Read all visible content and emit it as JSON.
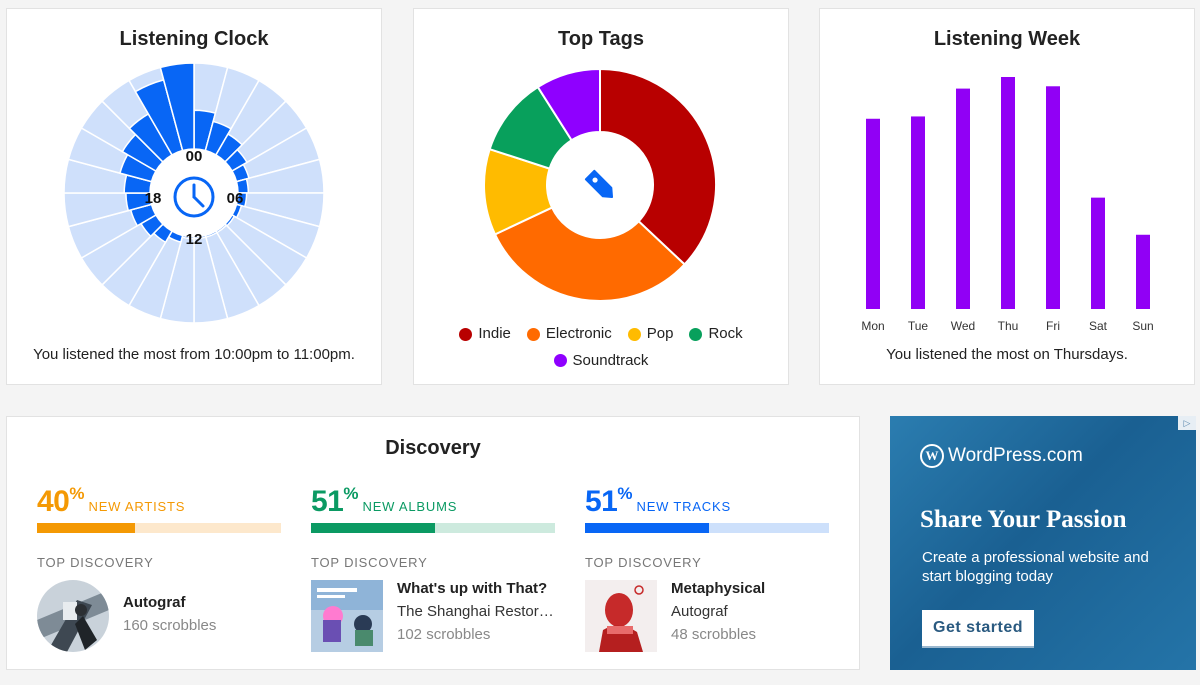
{
  "clock": {
    "title": "Listening Clock",
    "caption": "You listened the most from 10:00pm to 11:00pm.",
    "hour_labels": {
      "top": "00",
      "right": "06",
      "bottom": "12",
      "left": "18"
    },
    "icon": "clock-icon",
    "colors": {
      "bar": "#0866f5",
      "track": "#cfe0fb"
    },
    "hour_levels": [
      0.45,
      0.35,
      0.28,
      0.2,
      0.15,
      0.12,
      0.1,
      0.06,
      0.03,
      0.02,
      0.02,
      0.02,
      0.02,
      0.08,
      0.15,
      0.2,
      0.25,
      0.28,
      0.3,
      0.38,
      0.45,
      0.55,
      0.85,
      1.0
    ]
  },
  "tags": {
    "title": "Top Tags",
    "icon": "tag-icon",
    "chart_data": {
      "type": "pie",
      "labels": [
        "Indie",
        "Electronic",
        "Pop",
        "Rock",
        "Soundtrack"
      ],
      "values": [
        37,
        31,
        12,
        11,
        9
      ],
      "colors": [
        "#b80000",
        "#ff6a00",
        "#ffbb00",
        "#08a05c",
        "#8f00ff"
      ]
    }
  },
  "week": {
    "title": "Listening Week",
    "caption": "You listened the most on Thursdays.",
    "chart_data": {
      "type": "bar",
      "categories": [
        "Mon",
        "Tue",
        "Wed",
        "Thu",
        "Fri",
        "Sat",
        "Sun"
      ],
      "values": [
        82,
        83,
        95,
        100,
        96,
        48,
        32
      ],
      "color": "#9100f5",
      "ylim": [
        0,
        100
      ]
    }
  },
  "discovery": {
    "title": "Discovery",
    "top_label": "TOP DISCOVERY",
    "columns": [
      {
        "pct": "40",
        "pct_sign": "%",
        "label": "NEW ARTISTS",
        "fill": 0.4,
        "color": "#f49904",
        "track": "#fde8cc",
        "name": "Autograf",
        "sub": "",
        "scrobbles": "160 scrobbles",
        "img": "artist-photo"
      },
      {
        "pct": "51",
        "pct_sign": "%",
        "label": "NEW ALBUMS",
        "fill": 0.51,
        "color": "#0b9a63",
        "track": "#cdeade",
        "name": "What's up with That?",
        "sub": "The Shanghai Restora...",
        "scrobbles": "102 scrobbles",
        "img": "album-cover"
      },
      {
        "pct": "51",
        "pct_sign": "%",
        "label": "NEW TRACKS",
        "fill": 0.51,
        "color": "#0866f5",
        "track": "#cde0fb",
        "name": "Metaphysical",
        "sub": "Autograf",
        "scrobbles": "48 scrobbles",
        "img": "track-cover"
      }
    ]
  },
  "ad": {
    "brand": "WordPress.com",
    "brand_mark": "W",
    "headline": "Share Your Passion",
    "body": "Create a professional website and start blogging today",
    "button": "Get started",
    "badge_icon": "ad-choices-icon"
  }
}
